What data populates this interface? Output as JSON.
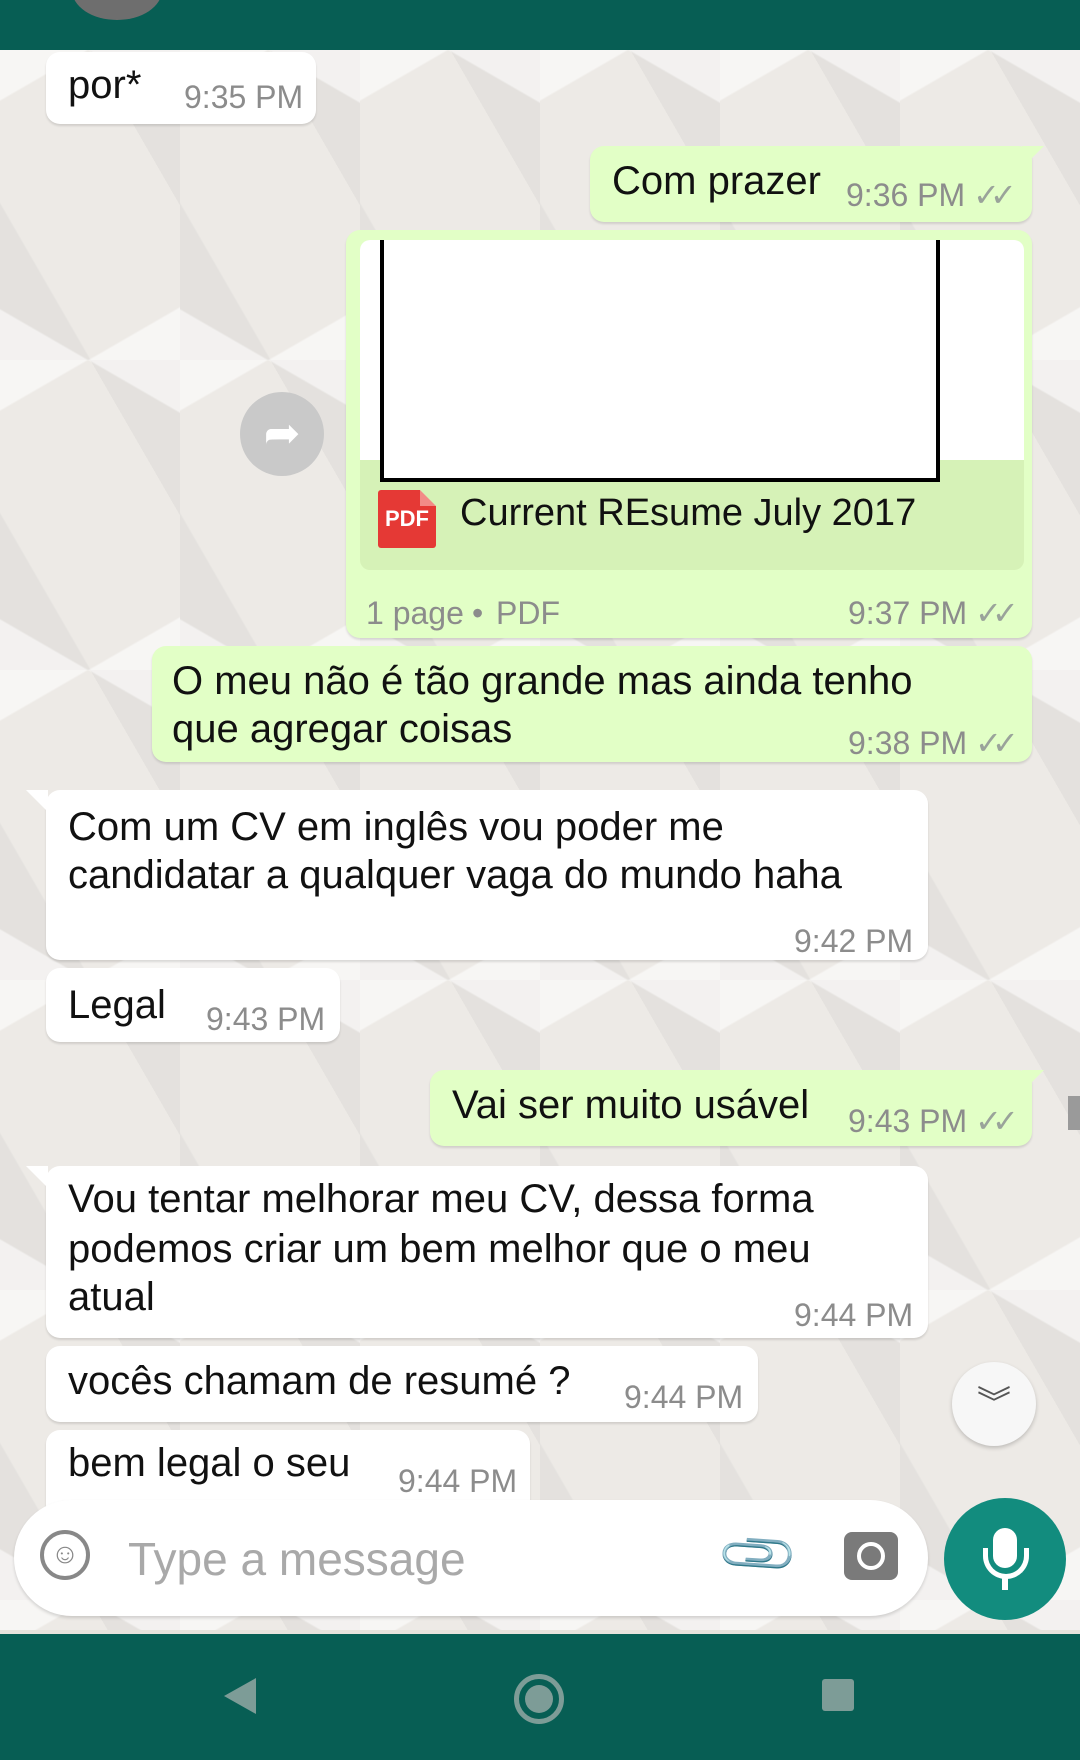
{
  "messages": [
    {
      "dir": "in",
      "text": "por*",
      "time": "9:35 PM"
    },
    {
      "dir": "out",
      "text": "Com prazer",
      "time": "9:36 PM"
    },
    {
      "dir": "out",
      "type": "document",
      "file_name": "Current REsume July 2017",
      "file_type_badge": "PDF",
      "meta_pages": "1 page",
      "meta_sep": "•",
      "meta_type": "PDF",
      "time": "9:37 PM"
    },
    {
      "dir": "out",
      "text_line1": "O meu não é tão grande mas ainda tenho",
      "text_line2": "que agregar coisas",
      "time": "9:38 PM"
    },
    {
      "dir": "in",
      "text_line1": "Com um CV em inglês vou poder me",
      "text_line2": "candidatar a qualquer vaga do mundo haha",
      "time": "9:42 PM"
    },
    {
      "dir": "in",
      "text": "Legal",
      "time": "9:43 PM"
    },
    {
      "dir": "out",
      "text": "Vai ser muito usável",
      "time": "9:43 PM"
    },
    {
      "dir": "in",
      "text_line1": "Vou tentar melhorar meu CV, dessa forma",
      "text_line2": "podemos criar um bem melhor que o meu",
      "text_line3": "atual",
      "time": "9:44 PM"
    },
    {
      "dir": "in",
      "text": "vocês chamam de resumé ?",
      "time": "9:44 PM"
    },
    {
      "dir": "in",
      "text": "bem legal o seu",
      "time": "9:44 PM"
    }
  ],
  "read_ticks": "✓✓",
  "input": {
    "placeholder": "Type a message"
  },
  "icons": {
    "forward": "forward-arrow-icon",
    "scroll": "double-chevron-down-icon",
    "emoji": "smiley-icon",
    "attach": "paperclip-icon",
    "camera": "camera-icon",
    "mic": "microphone-icon",
    "nav_back": "back-triangle-icon",
    "nav_home": "home-circle-icon",
    "nav_recent": "recents-square-icon"
  },
  "colors": {
    "header": "#075e54",
    "outgoing": "#e2ffc6",
    "incoming": "#ffffff",
    "mic": "#128c7e",
    "pdf_badge": "#e53935"
  }
}
